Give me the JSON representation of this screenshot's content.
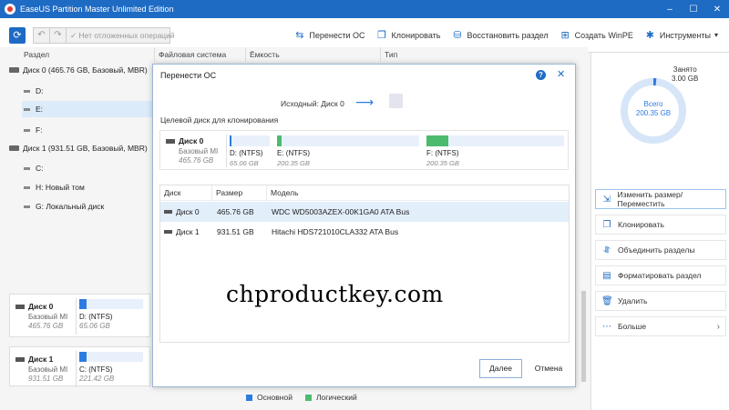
{
  "window": {
    "title": "EaseUS Partition Master Unlimited Edition",
    "minimize": "–",
    "maximize": "☐",
    "close": "✕"
  },
  "toolbar": {
    "pending": "Нет отложенных операций",
    "migrate_os": "Перенести ОС",
    "clone": "Клонировать",
    "restore": "Восстановить раздел",
    "winpe": "Создать WinPE",
    "tools": "Инструменты"
  },
  "columns": [
    "Раздел",
    "Файловая система",
    "Ёмкость",
    "Тип"
  ],
  "tree": [
    {
      "label": "Диск 0 (465.76 GB, Базовый, MBR)",
      "kind": "disk"
    },
    {
      "label": "D:",
      "kind": "part"
    },
    {
      "label": "E:",
      "kind": "part",
      "selected": true
    },
    {
      "label": "F:",
      "kind": "part"
    },
    {
      "label": "Диск 1 (931.51 GB, Базовый, MBR)",
      "kind": "disk"
    },
    {
      "label": "C:",
      "kind": "part"
    },
    {
      "label": "H: Новый том",
      "kind": "part"
    },
    {
      "label": "G: Локальный диск",
      "kind": "part"
    }
  ],
  "bottom_disks": [
    {
      "name": "Диск 0",
      "type": "Базовый MI",
      "size": "465.76 GB",
      "part_name": "D: (NTFS)",
      "part_size": "65.06 GB"
    },
    {
      "name": "Диск 1",
      "type": "Базовый MI",
      "size": "931.51 GB",
      "part_name": "C: (NTFS)",
      "part_size": "221.42 GB"
    }
  ],
  "legend": {
    "primary": "Основной",
    "logical": "Логический",
    "primary_color": "#2d7be0",
    "logical_color": "#4cbb6e"
  },
  "right_panel": {
    "used_label": "Занято",
    "used_value": "3.00 GB",
    "free_label": "Всего",
    "free_value": "200.35 GB",
    "actions": [
      {
        "label": "Изменить размер/Переместить",
        "icon": "resize-icon"
      },
      {
        "label": "Клонировать",
        "icon": "clone-icon"
      },
      {
        "label": "Объединить разделы",
        "icon": "merge-icon"
      },
      {
        "label": "Форматировать раздел",
        "icon": "format-icon"
      },
      {
        "label": "Удалить",
        "icon": "trash-icon"
      },
      {
        "label": "Больше",
        "icon": "more-icon"
      }
    ]
  },
  "dialog": {
    "title": "Перенести ОС",
    "source_label": "Исходный: Диск 0",
    "target_label": "Целевой диск для клонирования",
    "target_disk": {
      "name": "Диск 0",
      "type": "Базовый MI",
      "size": "465.76 GB",
      "partitions": [
        {
          "name": "D:  (NTFS)",
          "size": "65.06 GB",
          "fill_color": "#2d7be0",
          "fill": 0.05
        },
        {
          "name": "E:  (NTFS)",
          "size": "200.35 GB",
          "fill_color": "#4cbb6e",
          "fill": 0.02
        },
        {
          "name": "F:  (NTFS)",
          "size": "200.35 GB",
          "fill_color": "#4cbb6e",
          "fill": 0.16
        }
      ]
    },
    "table": {
      "headers": [
        "Диск",
        "Размер",
        "Модель"
      ],
      "rows": [
        {
          "disk": "Диск 0",
          "size": "465.76 GB",
          "model": "WDC WD5003AZEX-00K1GA0 ATA Bus"
        },
        {
          "disk": "Диск 1",
          "size": "931.51 GB",
          "model": "Hitachi HDS721010CLA332 ATA Bus"
        }
      ]
    },
    "watermark": "chproductkey.com",
    "next": "Далее",
    "cancel": "Отмена"
  }
}
